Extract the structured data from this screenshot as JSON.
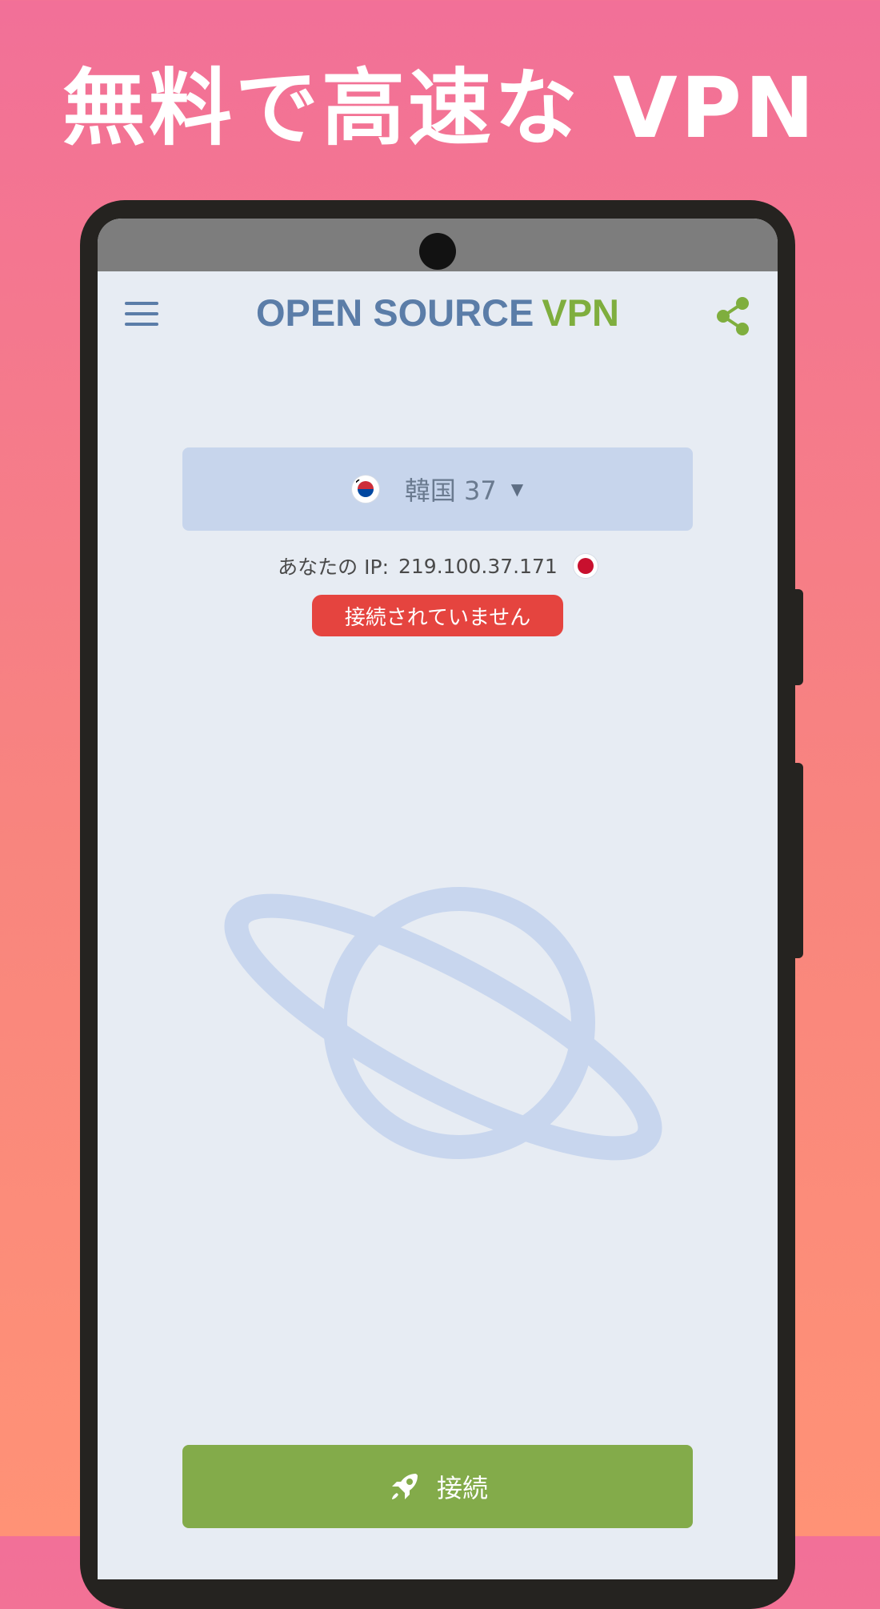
{
  "headline": "無料で高速な VPN",
  "app": {
    "title_part1": "OPEN SOURCE",
    "title_part2": "VPN",
    "menu_icon": "hamburger-menu-icon",
    "share_icon": "share-icon",
    "colors": {
      "title_blue": "#5B7DA8",
      "title_green": "#7FAE3E",
      "connect": "#83AB4A",
      "disconnected": "#E5443F"
    }
  },
  "server": {
    "flag_icon": "south-korea-flag-icon",
    "label": "韓国 37",
    "caret": "▼"
  },
  "ip": {
    "label": "あなたの IP:",
    "value": "219.100.37.171",
    "flag_icon": "japan-flag-icon"
  },
  "status": {
    "text": "接続されていません"
  },
  "connect": {
    "label": "接続",
    "icon": "rocket-icon"
  }
}
